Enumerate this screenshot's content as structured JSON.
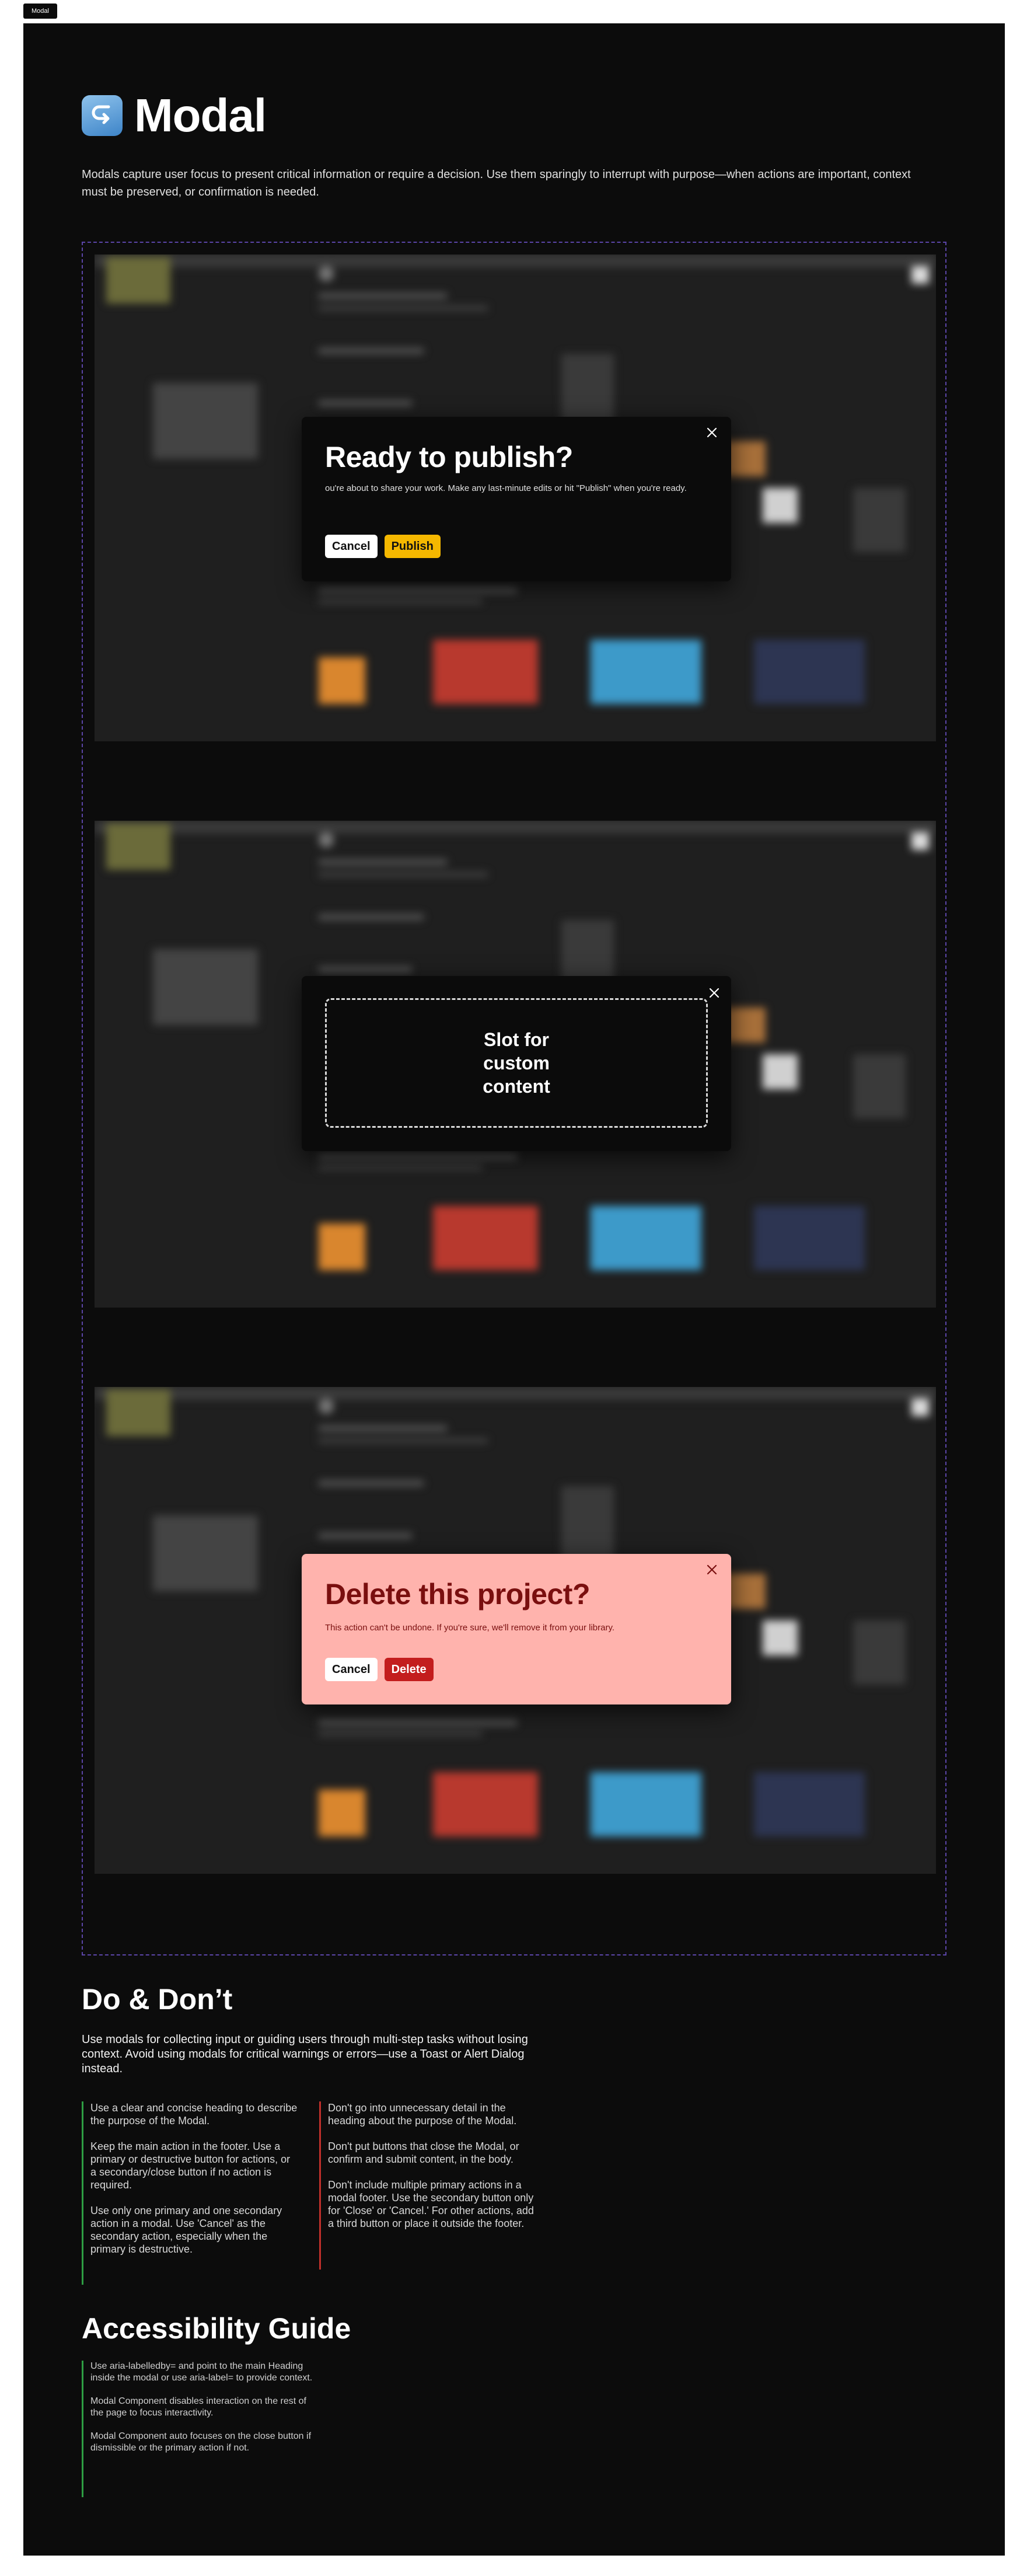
{
  "tab_label": "Modal",
  "page": {
    "title": "Modal",
    "intro": "Modals capture user focus to present critical information or require a decision. Use them sparingly to interrupt with purpose—when actions are important, context must be preserved, or confirmation is needed."
  },
  "examples": {
    "publish": {
      "title": "Ready to publish?",
      "message": "ou're about to share your work. Make any last-minute edits or hit \"Publish\" when you're ready.",
      "cancel_label": "Cancel",
      "confirm_label": "Publish"
    },
    "slot": {
      "text": "Slot for custom content"
    },
    "delete": {
      "title": "Delete this project?",
      "message": "This action can't be undone. If you're sure, we'll remove it from your library.",
      "cancel_label": "Cancel",
      "confirm_label": "Delete"
    }
  },
  "do_dont": {
    "heading": "Do & Don’t",
    "intro": "Use modals for collecting input or guiding users through multi-step tasks without losing context. Avoid using modals for critical warnings or errors—use a Toast or Alert Dialog instead.",
    "do": [
      "Use a clear and concise heading to describe the purpose of the Modal.",
      "Keep the main action in the footer. Use a primary or destructive button for actions, or a secondary/close button if no action is required.",
      "Use only one primary and one secondary action in a modal. Use 'Cancel' as the secondary action, especially when the primary is destructive."
    ],
    "dont": [
      "Don't go into unnecessary detail in the heading about the purpose of the Modal.",
      "Don't put buttons that close the Modal, or confirm and submit content, in the body.",
      "Don't include multiple primary actions in a modal footer. Use the secondary button only for 'Close' or 'Cancel.' For other actions, add a third button or place it outside the footer."
    ]
  },
  "accessibility": {
    "heading": "Accessibility Guide",
    "items": [
      "Use aria-labelledby= and point to the main Heading inside the modal or use aria-label= to provide context.",
      "Modal Component disables interaction on the rest of the page to focus interactivity.",
      "Modal Component auto focuses on the close button if dismissible or the primary action if not."
    ]
  },
  "colors": {
    "background": "#0c0c0c",
    "accent_publish": "#f5b800",
    "danger_bg": "#ffb3ad",
    "danger_text": "#7a0f0f",
    "danger_button": "#c31d1d",
    "do_border": "#2e9e43",
    "dont_border": "#c0302b",
    "dashed_border": "#5b45a8"
  },
  "icons": {
    "title_icon": "return-arrow-icon",
    "close_icon": "close-icon"
  }
}
